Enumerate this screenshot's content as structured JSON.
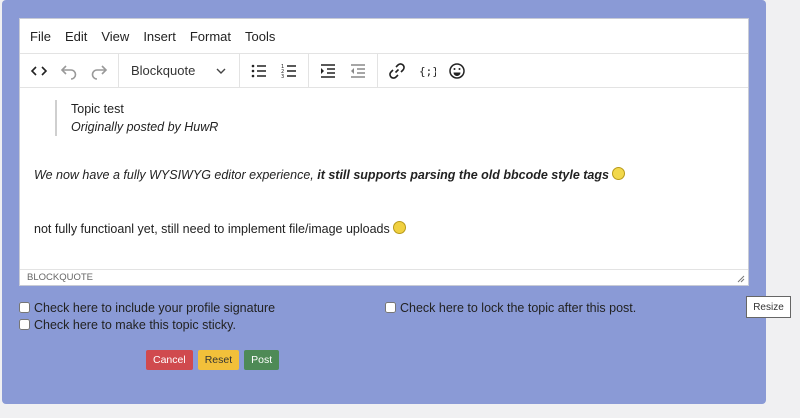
{
  "menu": [
    "File",
    "Edit",
    "View",
    "Insert",
    "Format",
    "Tools"
  ],
  "toolbar": {
    "block_format": "Blockquote",
    "icons": [
      "code-view-icon",
      "undo-icon",
      "redo-icon",
      "bullet-list-icon",
      "numbered-list-icon",
      "indent-icon",
      "outdent-icon",
      "link-icon",
      "code-block-icon",
      "emoji-icon"
    ]
  },
  "content": {
    "quote_title": "Topic test",
    "quote_by": "Originally posted by HuwR",
    "p1_text": "We now have a fully WYSIWYG editor experience, ",
    "p1_bold": "it still supports parsing the old bbcode style tags",
    "p2_text": "not fully functioanl yet, still need to implement file/image uploads"
  },
  "status": {
    "path": "BLOCKQUOTE"
  },
  "options": {
    "signature": "Check here to include your profile signature",
    "sticky": "Check here to make this topic sticky.",
    "lock": "Check here to lock the topic after this post."
  },
  "tooltip": "Resize",
  "buttons": {
    "cancel": "Cancel",
    "reset": "Reset",
    "post": "Post"
  },
  "colors": {
    "panel": "#8a9ad6",
    "cancel": "#d04a4e",
    "reset": "#f2c03a",
    "post": "#4e8a56"
  }
}
